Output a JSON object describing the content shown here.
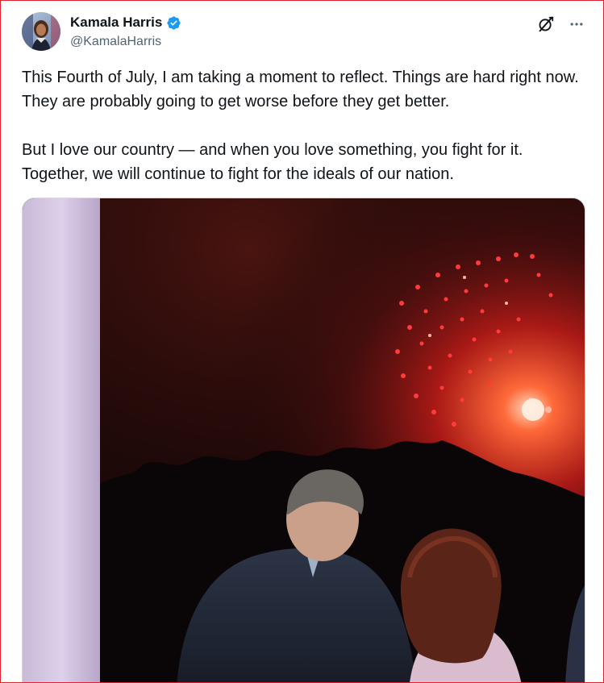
{
  "author": {
    "name": "Kamala Harris",
    "handle": "@KamalaHarris",
    "verified": true,
    "verified_icon": "verified-badge-icon",
    "avatar_icon": "avatar"
  },
  "actions": {
    "grok_icon": "grok-icon",
    "more_icon": "more-options-icon"
  },
  "tweet": {
    "paragraph_1": "This Fourth of July, I am taking a moment to reflect. Things are hard right now. They are probably going to get worse before they get better.",
    "paragraph_2": "But I love our country — and when you love something, you fight for it. Together, we will continue to fight for the ideals of our nation."
  },
  "media": {
    "type": "photo",
    "description_icon": "fireworks-photo"
  },
  "colors": {
    "verified": "#1d9bf0",
    "text": "#0f1419",
    "secondary": "#536471",
    "frame": "#e0202a"
  }
}
